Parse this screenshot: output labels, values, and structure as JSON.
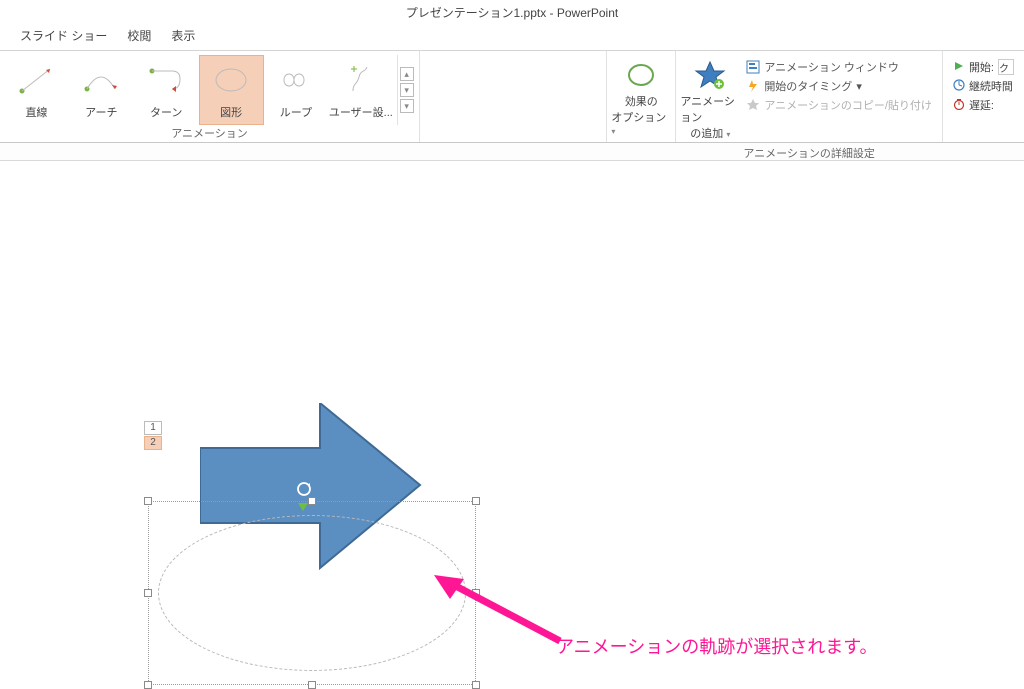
{
  "title": "プレゼンテーション1.pptx - PowerPoint",
  "tabs": [
    "スライド ショー",
    "校閲",
    "表示"
  ],
  "ribbon": {
    "animation_group_label": "アニメーション",
    "thumbs": [
      {
        "label": "直線"
      },
      {
        "label": "アーチ"
      },
      {
        "label": "ターン"
      },
      {
        "label": "図形",
        "selected": true
      },
      {
        "label": "ループ"
      },
      {
        "label": "ユーザー設..."
      }
    ],
    "effect_options": {
      "line1": "効果の",
      "line2": "オプション"
    },
    "add_animation": {
      "line1": "アニメーション",
      "line2": "の追加"
    },
    "adv_group_label": "アニメーションの詳細設定",
    "adv_items": {
      "pane": "アニメーション ウィンドウ",
      "trigger": "開始のタイミング",
      "painter": "アニメーションのコピー/貼り付け"
    },
    "timing": {
      "start": "開始:",
      "start_value": "ク",
      "duration": "継続時間",
      "delay": "遅延:"
    }
  },
  "slide": {
    "order_1": "1",
    "order_2": "2"
  },
  "annotation": "アニメーションの軌跡が選択されます。"
}
